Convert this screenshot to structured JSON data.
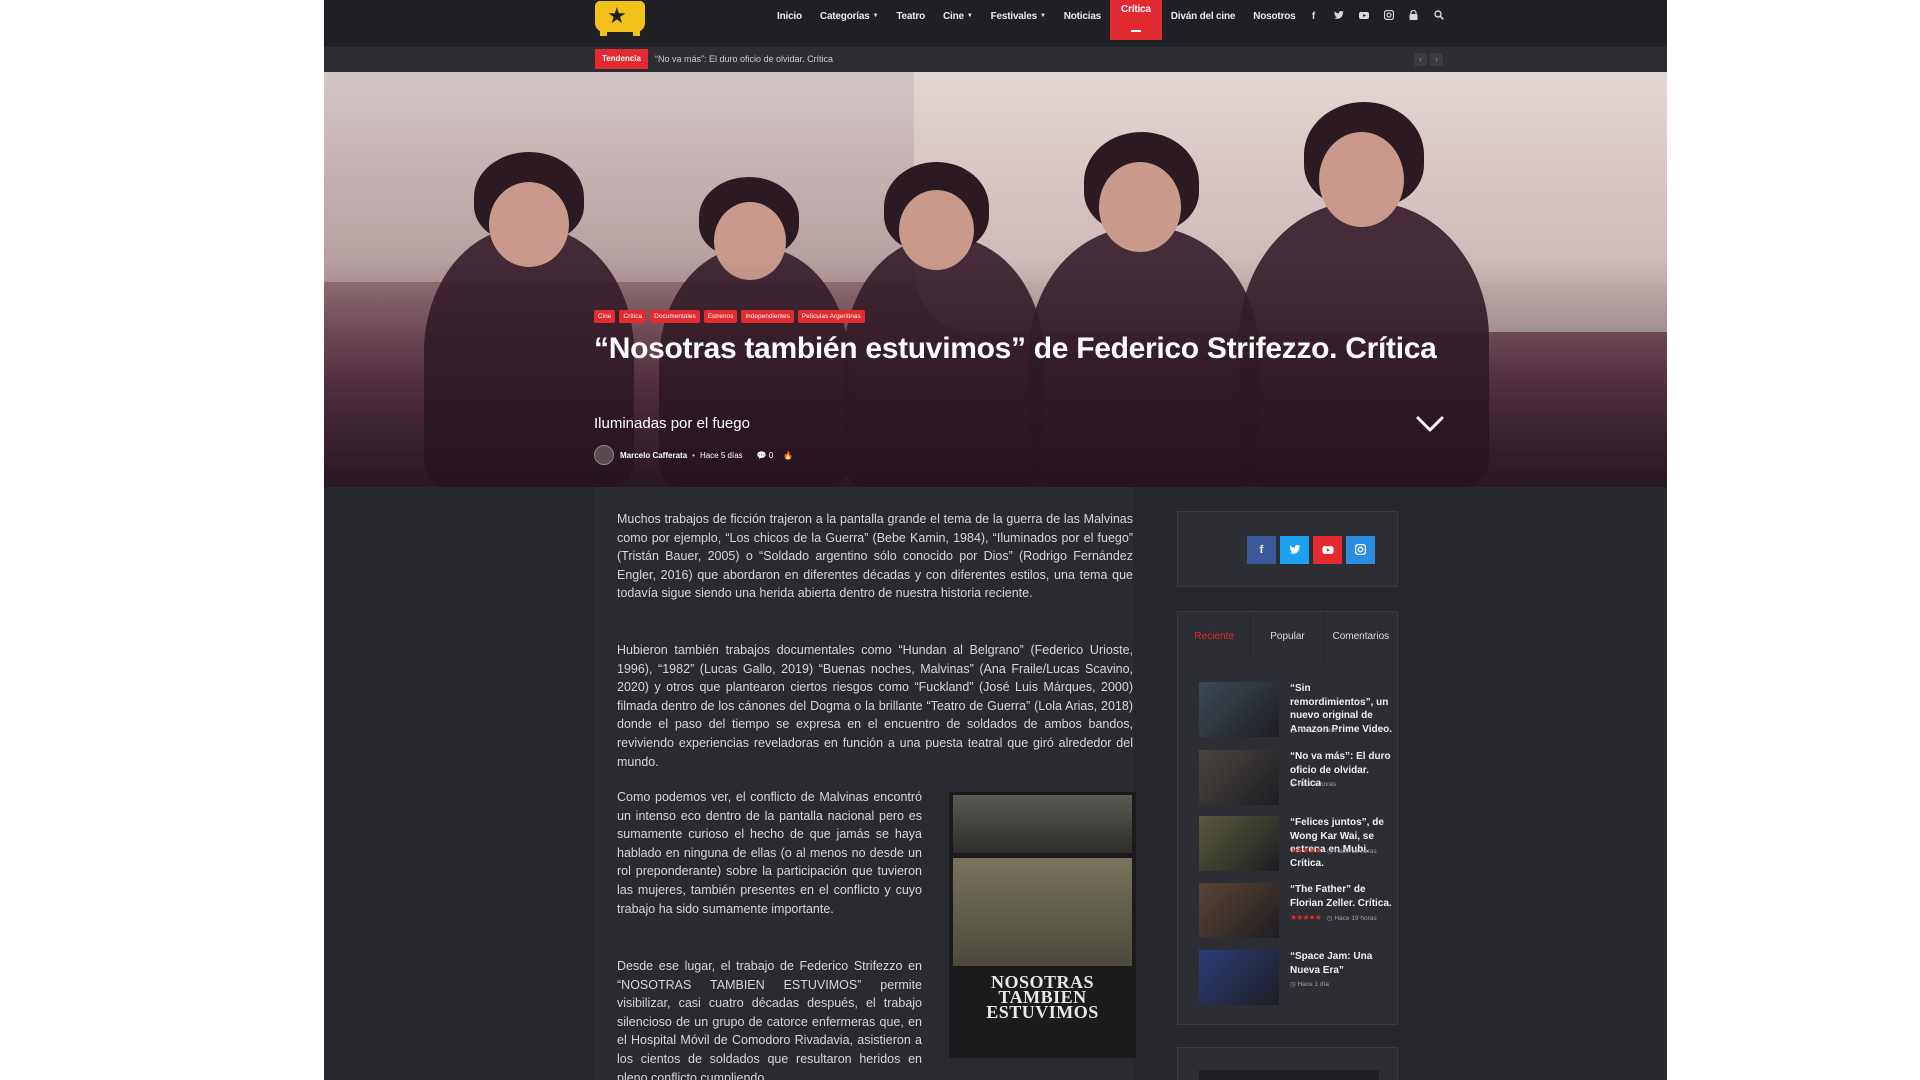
{
  "nav": {
    "items": [
      {
        "label": "Inicio",
        "dropdown": false
      },
      {
        "label": "Categorías",
        "dropdown": true
      },
      {
        "label": "Teatro",
        "dropdown": false
      },
      {
        "label": "Cine",
        "dropdown": true
      },
      {
        "label": "Festivales",
        "dropdown": true
      },
      {
        "label": "Noticias",
        "dropdown": false
      },
      {
        "label": "Crítica",
        "dropdown": false,
        "active": true
      },
      {
        "label": "Diván del cine",
        "dropdown": false
      },
      {
        "label": "Nosotros",
        "dropdown": false
      }
    ],
    "icons": [
      "facebook-icon",
      "twitter-icon",
      "youtube-icon",
      "instagram-icon",
      "lock-icon",
      "search-icon"
    ]
  },
  "trending": {
    "label": "Tendencia",
    "text": "“No va más”: El duro oficio de olvidar. Crítica"
  },
  "hero": {
    "tags": [
      "Cine",
      "Crítica",
      "Documentales",
      "Estrenos",
      "Independientes",
      "Películas Argentinas"
    ],
    "title": "“Nosotras también estuvimos” de Federico Strifezzo. Crítica",
    "subtitle": "Iluminadas por el fuego",
    "author": "Marcelo Cafferata",
    "time": "Hace 5 días",
    "comments": "0"
  },
  "article": {
    "p1": "Muchos trabajos de ficción trajeron a la pantalla grande el tema de la guerra de las Malvinas como por ejemplo, “Los chicos de la Guerra” (Bebe Kamin, 1984), “Iluminados por el fuego” (Tristán Bauer, 2005) o “Soldado argentino sólo conocido por Dios” (Rodrigo Fernández Engler, 2016) que abordaron en diferentes décadas y con diferentes estilos, una tema que todavía sigue siendo una herida abierta dentro de nuestra historia reciente.",
    "p2": "Hubieron también trabajos documentales como “Hundan al Belgrano” (Federico Urioste, 1996), “1982” (Lucas Gallo, 2019) “Buenas noches, Malvinas” (Ana Fraile/Lucas Scavino, 2020) y otros que plantearon ciertos riesgos como “Fuckland” (José Luis Márques, 2000) filmada dentro de los cánones del Dogma o la brillante “Teatro de Guerra” (Lola Arias, 2018) donde el paso del tiempo se expresa en el encuentro de soldados de ambos bandos, reviviendo experiencias reveladoras en función a una puesta teatral que giró alrededor del mundo.",
    "p3": "Como podemos ver, el conflicto de Malvinas encontró un intenso eco dentro de la pantalla nacional pero es sumamente curioso el hecho de que jamás se haya hablado en ninguna de ellas (o al menos no desde un rol preponderante) sobre la participación que tuvieron las mujeres, también presentes en el conflicto y cuyo trabajo ha sido sumamente importante.",
    "p4": "Desde ese lugar, el trabajo de Federico Strifezzo en “NOSOTRAS TAMBIEN ESTUVIMOS” permite visibilizar, casi cuatro décadas después, el trabajo silencioso de un grupo de catorce enfermeras que, en el Hospital Móvil de Comodoro Rivadavia, asistieron a los cientos de soldados que resultaron heridos en pleno conflicto cumpliendo",
    "poster_title_1": "NOSOTRAS",
    "poster_title_2": "TAMBIEN",
    "poster_title_3": "ESTUVIMOS"
  },
  "sidebar": {
    "tabs": [
      "Reciente",
      "Popular",
      "Comentarios"
    ],
    "posts": [
      {
        "title": "“Sin remordimientos”, un nuevo original de Amazon Prime Video.",
        "time": "Hace 37 mins",
        "rated": false,
        "thumb": "#3d4a55"
      },
      {
        "title": "“No va más”: El duro oficio de olvidar. Crítica",
        "time": "Hace 5 horas",
        "rated": false,
        "thumb": "#4a4540"
      },
      {
        "title": "“Felices juntos”, de Wong Kar Wai, se estrena en Mubi. Crítica.",
        "time": "Hace 18 horas",
        "rated": true,
        "thumb": "#5a5a3e"
      },
      {
        "title": "“The Father” de Florian Zeller. Crítica.",
        "time": "Hace 19 horas",
        "rated": true,
        "thumb": "#5b4536"
      },
      {
        "title": "“Space Jam: Una Nueva Era”",
        "time": "Hace 1 día",
        "rated": false,
        "thumb": "#2c3d7a"
      }
    ],
    "stars": "★★★★★"
  },
  "colors": {
    "accent": "#e22a30",
    "logo": "#f2c21b",
    "facebook": "#3b5998",
    "twitter": "#1da1f2",
    "youtube": "#e22a30",
    "instagram": "#2a8de0"
  }
}
